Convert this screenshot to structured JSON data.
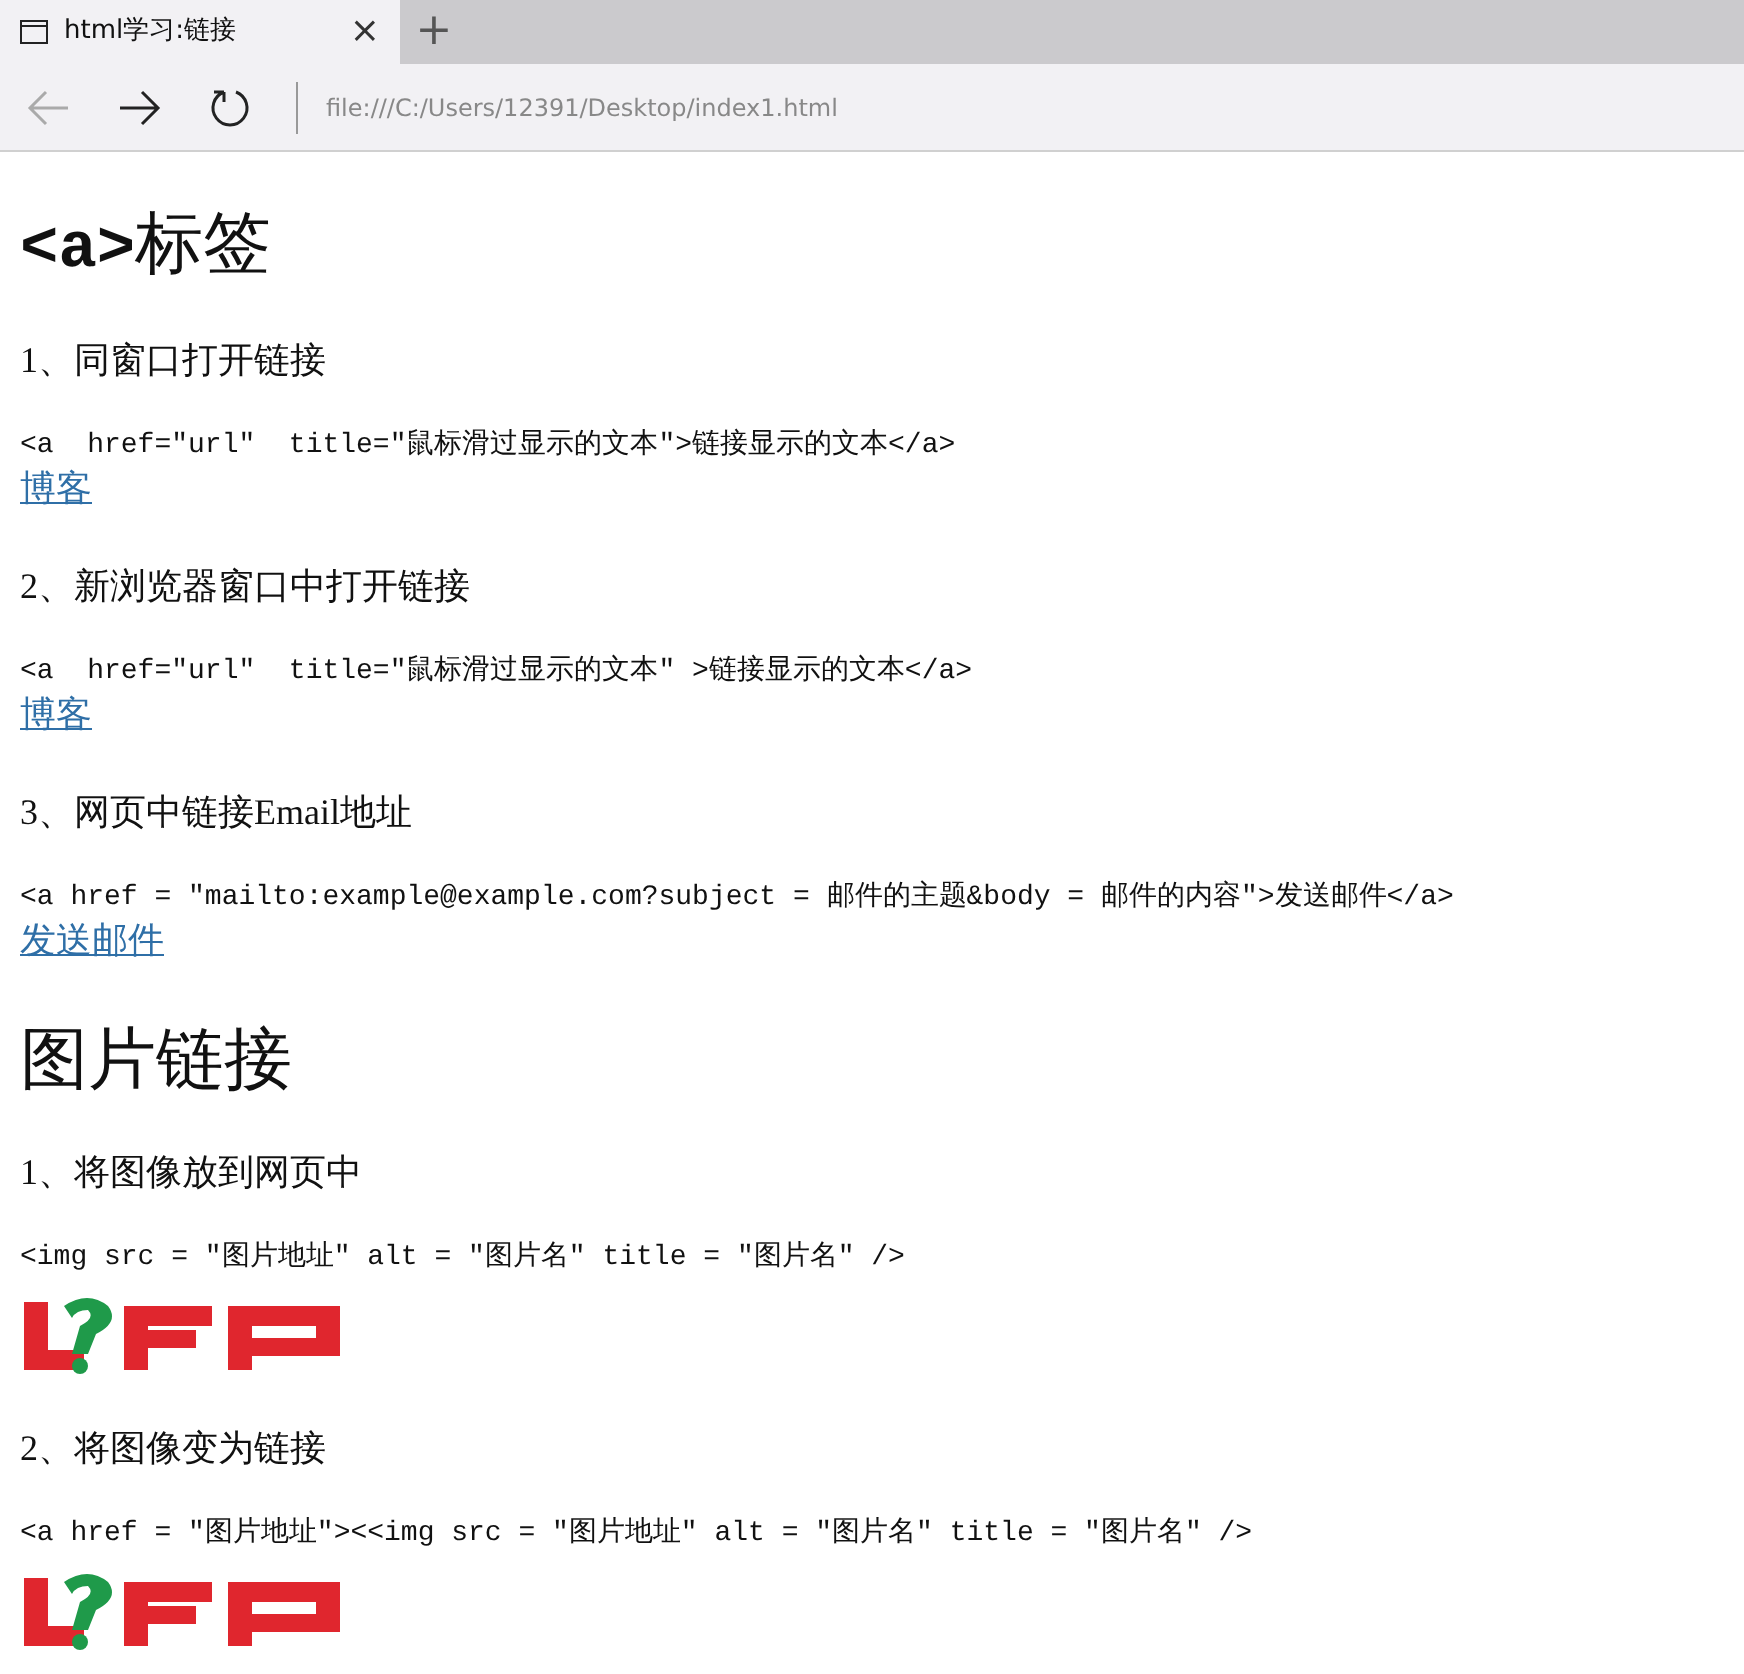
{
  "tab": {
    "title": "html学习:链接",
    "close": "×",
    "new_tab": "+"
  },
  "address_bar": {
    "url": "file:///C:/Users/12391/Desktop/index1.html"
  },
  "content": [
    {
      "kind": "heading",
      "parts": [
        {
          "text": "<a>",
          "code": true
        },
        {
          "text": "标签",
          "code": false
        }
      ]
    },
    {
      "kind": "paragraph",
      "text": "1、同窗口打开链接"
    },
    {
      "kind": "code",
      "text": "<a  href=\"url\"  title=\"鼠标滑过显示的文本\">链接显示的文本</a>"
    },
    {
      "kind": "link",
      "text": "博客"
    },
    {
      "kind": "paragraph",
      "text": "2、新浏览器窗口中打开链接"
    },
    {
      "kind": "code",
      "text": "<a  href=\"url\"  title=\"鼠标滑过显示的文本\" >链接显示的文本</a>"
    },
    {
      "kind": "link",
      "text": "博客"
    },
    {
      "kind": "paragraph",
      "text": "3、网页中链接Email地址"
    },
    {
      "kind": "code",
      "text": "<a href = \"mailto:example@example.com?subject = 邮件的主题&body = 邮件的内容\">发送邮件</a>"
    },
    {
      "kind": "link",
      "text": "发送邮件"
    },
    {
      "kind": "heading",
      "parts": [
        {
          "text": "图片链接",
          "code": false
        }
      ]
    },
    {
      "kind": "paragraph",
      "text": "1、将图像放到网页中"
    },
    {
      "kind": "code",
      "text": "<img src = \"图片地址\" alt = \"图片名\" title = \"图片名\" />"
    },
    {
      "kind": "picture"
    },
    {
      "kind": "paragraph",
      "text": "2、将图像变为链接"
    },
    {
      "kind": "code",
      "text": "<a href = \"图片地址\"><<img src = \"图片地址\" alt = \"图片名\" title = \"图片名\" />"
    },
    {
      "kind": "picture"
    }
  ]
}
